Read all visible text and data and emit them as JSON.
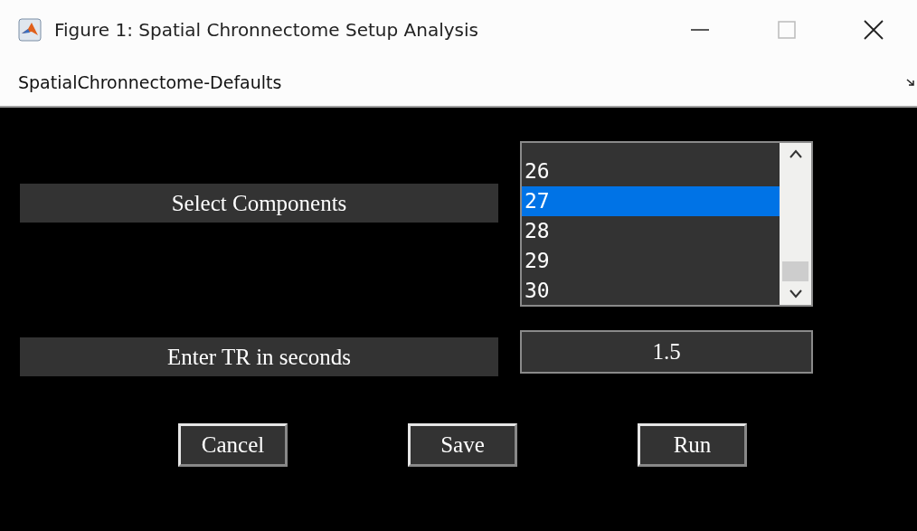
{
  "window": {
    "title": "Figure 1: Spatial Chronnectome Setup Analysis"
  },
  "toolbar": {
    "title": "SpatialChronnectome-Defaults"
  },
  "components": {
    "label": "Select Components",
    "items": [
      {
        "label": "26",
        "selected": false
      },
      {
        "label": "27",
        "selected": true
      },
      {
        "label": "28",
        "selected": false
      },
      {
        "label": "29",
        "selected": false
      },
      {
        "label": "30",
        "selected": false
      }
    ]
  },
  "tr": {
    "label": "Enter TR in seconds",
    "value": "1.5"
  },
  "buttons": [
    "Cancel",
    "Save",
    "Run"
  ]
}
